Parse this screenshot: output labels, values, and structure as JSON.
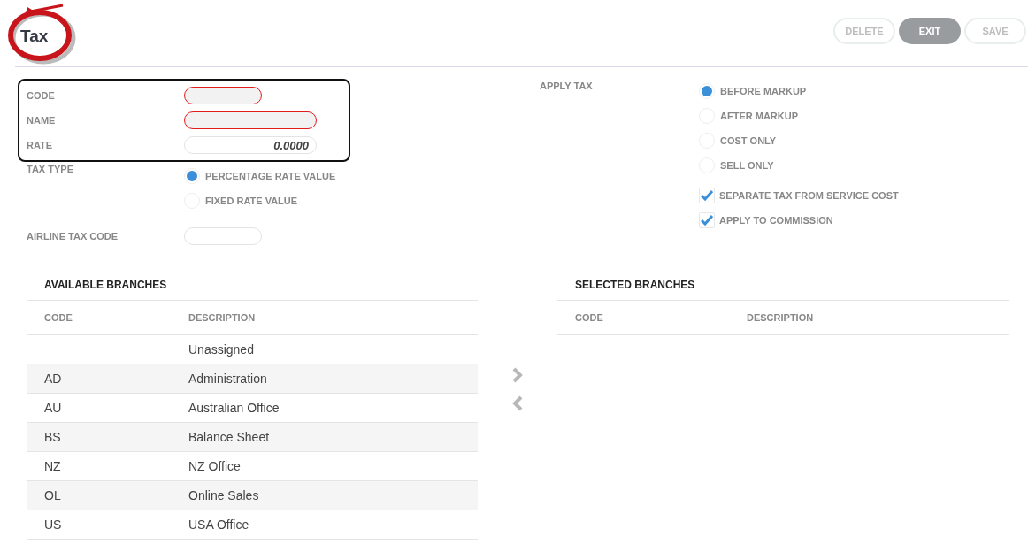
{
  "header": {
    "title": "Tax",
    "buttons": [
      {
        "label": "DELETE",
        "disabled": true
      },
      {
        "label": "EXIT",
        "disabled": false
      },
      {
        "label": "SAVE",
        "disabled": true
      }
    ]
  },
  "fields": [
    {
      "label": "CODE",
      "invalid": true,
      "wide": false
    },
    {
      "label": "NAME",
      "invalid": true,
      "wide": true
    },
    {
      "label": "RATE",
      "invalid": false,
      "wide": true,
      "value": "0.0000"
    }
  ],
  "tax_type": {
    "label": "TAX TYPE",
    "options": [
      {
        "label": "PERCENTAGE RATE VALUE",
        "selected": true
      },
      {
        "label": "FIXED RATE VALUE",
        "selected": false
      }
    ]
  },
  "airline_tax_code": {
    "label": "AIRLINE TAX CODE"
  },
  "apply_tax": {
    "label": "APPLY TAX",
    "options": [
      {
        "label": "BEFORE MARKUP",
        "selected": true
      },
      {
        "label": "AFTER MARKUP",
        "selected": false
      },
      {
        "label": "COST ONLY",
        "selected": false
      },
      {
        "label": "SELL ONLY",
        "selected": false
      }
    ]
  },
  "checkboxes": [
    {
      "label": "SEPARATE TAX FROM SERVICE COST",
      "checked": true
    },
    {
      "label": "APPLY TO COMMISSION",
      "checked": true
    }
  ],
  "available_branches": {
    "title": "AVAILABLE BRANCHES",
    "columns": [
      "CODE",
      "DESCRIPTION"
    ],
    "rows": [
      {
        "code": "",
        "description": "Unassigned"
      },
      {
        "code": "AD",
        "description": "Administration"
      },
      {
        "code": "AU",
        "description": "Australian Office"
      },
      {
        "code": "BS",
        "description": "Balance Sheet"
      },
      {
        "code": "NZ",
        "description": "NZ Office"
      },
      {
        "code": "OL",
        "description": "Online Sales"
      },
      {
        "code": "US",
        "description": "USA Office"
      }
    ]
  },
  "selected_branches": {
    "title": "SELECTED BRANCHES",
    "columns": [
      "CODE",
      "DESCRIPTION"
    ]
  }
}
